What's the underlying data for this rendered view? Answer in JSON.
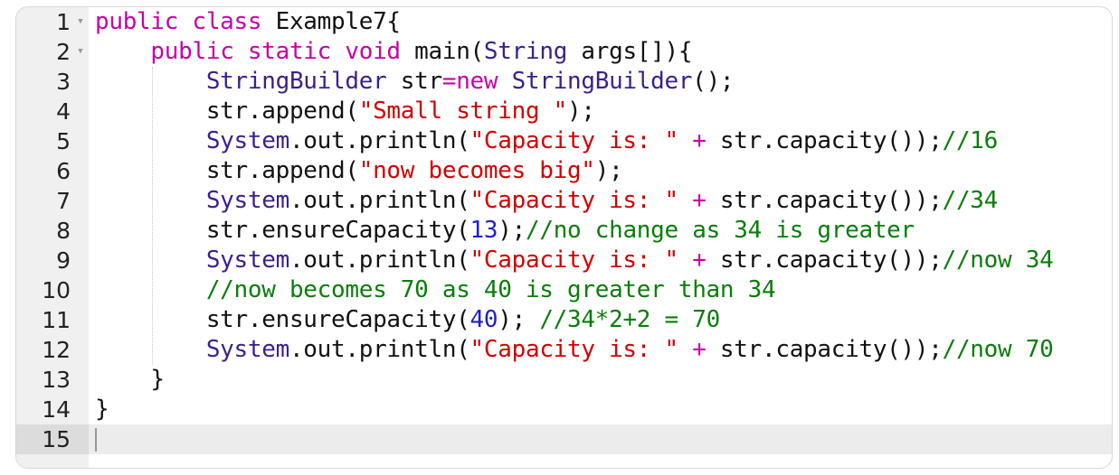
{
  "editor": {
    "language": "java",
    "active_line": 15,
    "colors": {
      "keyword": "#c800a4",
      "type": "#3b1f8c",
      "string": "#d10000",
      "number": "#2020c8",
      "comment": "#0a7d0a",
      "plain": "#111111",
      "gutter_bg": "#f0f0f0",
      "active_line_bg": "#ececec"
    },
    "lines": [
      {
        "n": "1",
        "fold": true,
        "tokens": [
          [
            "kw",
            "public class "
          ],
          [
            "pl",
            "Example7{"
          ]
        ]
      },
      {
        "n": "2",
        "fold": true,
        "tokens": [
          [
            "pl",
            "    "
          ],
          [
            "kw",
            "public static void "
          ],
          [
            "pl",
            "main("
          ],
          [
            "ty",
            "String"
          ],
          [
            "pl",
            " args[]){"
          ]
        ]
      },
      {
        "n": "3",
        "fold": false,
        "tokens": [
          [
            "pl",
            "        "
          ],
          [
            "ty",
            "StringBuilder"
          ],
          [
            "pl",
            " str"
          ],
          [
            "kw",
            "=new "
          ],
          [
            "ty",
            "StringBuilder"
          ],
          [
            "pl",
            "();"
          ]
        ]
      },
      {
        "n": "4",
        "fold": false,
        "tokens": [
          [
            "pl",
            "        str.append("
          ],
          [
            "st",
            "\"Small string \""
          ],
          [
            "pl",
            ");"
          ]
        ]
      },
      {
        "n": "5",
        "fold": false,
        "tokens": [
          [
            "pl",
            "        "
          ],
          [
            "ty",
            "System"
          ],
          [
            "pl",
            ".out.println("
          ],
          [
            "st",
            "\"Capacity is: \""
          ],
          [
            "pl",
            " "
          ],
          [
            "kw",
            "+"
          ],
          [
            "pl",
            " str.capacity());"
          ],
          [
            "cm",
            "//16"
          ]
        ]
      },
      {
        "n": "6",
        "fold": false,
        "tokens": [
          [
            "pl",
            "        str.append("
          ],
          [
            "st",
            "\"now becomes big\""
          ],
          [
            "pl",
            ");"
          ]
        ]
      },
      {
        "n": "7",
        "fold": false,
        "tokens": [
          [
            "pl",
            "        "
          ],
          [
            "ty",
            "System"
          ],
          [
            "pl",
            ".out.println("
          ],
          [
            "st",
            "\"Capacity is: \""
          ],
          [
            "pl",
            " "
          ],
          [
            "kw",
            "+"
          ],
          [
            "pl",
            " str.capacity());"
          ],
          [
            "cm",
            "//34"
          ]
        ]
      },
      {
        "n": "8",
        "fold": false,
        "tokens": [
          [
            "pl",
            "        str.ensureCapacity("
          ],
          [
            "nu",
            "13"
          ],
          [
            "pl",
            ");"
          ],
          [
            "cm",
            "//no change as 34 is greater"
          ]
        ]
      },
      {
        "n": "9",
        "fold": false,
        "tokens": [
          [
            "pl",
            "        "
          ],
          [
            "ty",
            "System"
          ],
          [
            "pl",
            ".out.println("
          ],
          [
            "st",
            "\"Capacity is: \""
          ],
          [
            "pl",
            " "
          ],
          [
            "kw",
            "+"
          ],
          [
            "pl",
            " str.capacity());"
          ],
          [
            "cm",
            "//now 34"
          ]
        ]
      },
      {
        "n": "10",
        "fold": false,
        "tokens": [
          [
            "pl",
            "        "
          ],
          [
            "cm",
            "//now becomes 70 as 40 is greater than 34"
          ]
        ]
      },
      {
        "n": "11",
        "fold": false,
        "tokens": [
          [
            "pl",
            "        str.ensureCapacity("
          ],
          [
            "nu",
            "40"
          ],
          [
            "pl",
            "); "
          ],
          [
            "cm",
            "//34*2+2 = 70"
          ]
        ]
      },
      {
        "n": "12",
        "fold": false,
        "tokens": [
          [
            "pl",
            "        "
          ],
          [
            "ty",
            "System"
          ],
          [
            "pl",
            ".out.println("
          ],
          [
            "st",
            "\"Capacity is: \""
          ],
          [
            "pl",
            " "
          ],
          [
            "kw",
            "+"
          ],
          [
            "pl",
            " str.capacity());"
          ],
          [
            "cm",
            "//now 70"
          ]
        ]
      },
      {
        "n": "13",
        "fold": false,
        "tokens": [
          [
            "pl",
            "    }"
          ]
        ]
      },
      {
        "n": "14",
        "fold": false,
        "tokens": [
          [
            "pl",
            "}"
          ]
        ]
      },
      {
        "n": "15",
        "fold": false,
        "tokens": []
      }
    ],
    "fold_icon": "triangle-down-icon"
  }
}
